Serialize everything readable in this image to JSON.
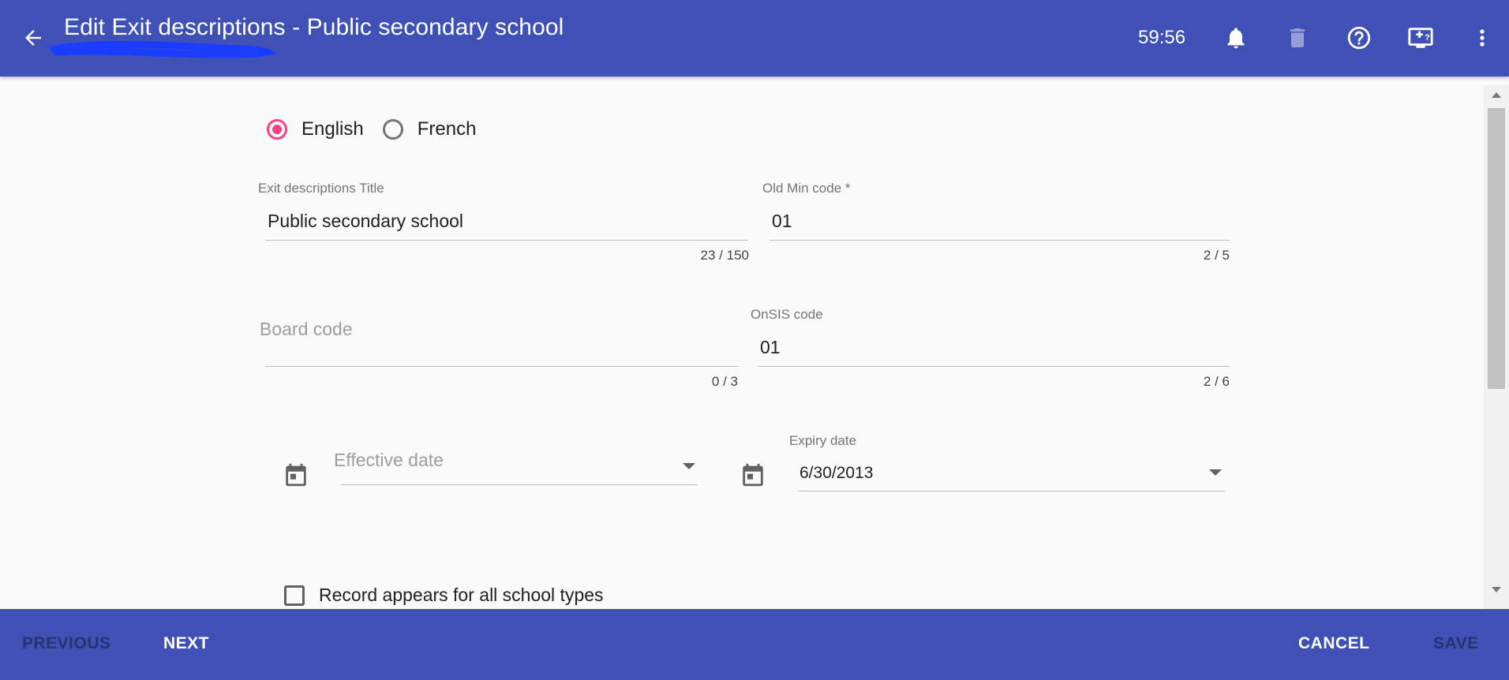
{
  "header": {
    "title": "Edit Exit descriptions - Public secondary school",
    "timer": "59:56",
    "bg_color": "#3f51b5",
    "icons": [
      "arrow-back-icon",
      "bell-icon",
      "trash-icon",
      "help-icon",
      "screen-help-icon",
      "more-vert-icon"
    ]
  },
  "language": {
    "options": [
      {
        "label": "English",
        "checked": true
      },
      {
        "label": "French",
        "checked": false
      }
    ],
    "accent_color": "#ff4081"
  },
  "form": {
    "exit_title": {
      "label": "Exit descriptions Title",
      "value": "Public secondary school",
      "counter": "23 / 150"
    },
    "old_min_code": {
      "label": "Old Min code *",
      "value": "01",
      "counter": "2 / 5"
    },
    "board_code": {
      "placeholder": "Board code",
      "value": "",
      "counter": "0 / 3"
    },
    "onsis_code": {
      "label": "OnSIS code",
      "value": "01",
      "counter": "2 / 6"
    },
    "effective_date": {
      "placeholder": "Effective date",
      "value": ""
    },
    "expiry_date": {
      "label": "Expiry date",
      "value": "6/30/2013"
    },
    "all_school_types": {
      "label": "Record appears for all school types",
      "checked": false
    }
  },
  "footer": {
    "previous": "PREVIOUS",
    "next": "NEXT",
    "cancel": "CANCEL",
    "save": "SAVE"
  }
}
